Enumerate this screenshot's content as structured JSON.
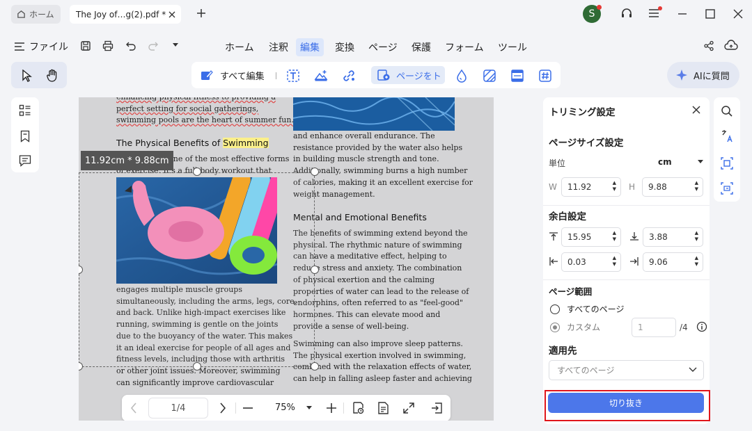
{
  "titlebar": {
    "home_tab": "ホーム",
    "doc_tab": "The Joy of…g(2).pdf *",
    "avatar_letter": "S"
  },
  "menubar": {
    "file_label": "ファイル",
    "menus": [
      "ホーム",
      "注釈",
      "編集",
      "変換",
      "ページ",
      "保護",
      "フォーム",
      "ツール"
    ],
    "active_menu": "編集"
  },
  "toolbar": {
    "edit_all": "すべて編集",
    "page_crop": "ページをト",
    "ai_button": "AIに質問"
  },
  "document": {
    "size_tooltip": "11.92cm * 9.88cm",
    "left_col_top": [
      "enhancing physical fitness to providing a",
      "perfect setting for social gatherings,",
      "swimming pools are the heart of summer fun."
    ],
    "heading1_prefix": "The Physical Benefits of ",
    "heading1_highlight": "Swimming",
    "left_col_mid": [
      "Swimming is one of the most effective forms",
      "of exercise. It's a full-body workout that"
    ],
    "left_col_bottom": [
      "engages multiple muscle groups",
      "simultaneously, including the arms, legs, core,",
      "and back. Unlike high-impact exercises like",
      "running, swimming is gentle on the joints",
      "due to the buoyancy of the water. This makes",
      "it an ideal exercise for people of all ages and",
      "fitness levels, including those with arthritis",
      "or other joint issues. Moreover, swimming",
      "can significantly improve cardiovascular"
    ],
    "right_col_top": [
      "and enhance overall endurance. The",
      "resistance provided by the water also helps",
      "in building muscle strength and tone.",
      "Additionally, swimming burns a high number",
      "of calories, making it an excellent exercise for",
      "weight management."
    ],
    "heading2": "Mental and Emotional Benefits",
    "right_col_mid": [
      "The benefits of swimming extend beyond the",
      "physical. The rhythmic nature of swimming",
      "can have a meditative effect, helping to",
      "reduce stress and anxiety. The combination",
      "of physical exertion and the calming",
      "properties of water can lead to the release of",
      "endorphins, often referred to as \"feel-good\"",
      "hormones. This can elevate mood and",
      "provide a sense of well-being."
    ],
    "right_col_bottom": [
      "Swimming can also improve sleep patterns.",
      "The physical exertion involved in swimming,",
      "combined with the relaxation effects of water,",
      "can help in falling asleep faster and achieving"
    ]
  },
  "pagenav": {
    "page": "1/4",
    "zoom": "75%"
  },
  "crop_panel": {
    "title": "トリミング設定",
    "page_size_title": "ページサイズ設定",
    "unit_label": "単位",
    "unit_value": "cm",
    "w_label": "W",
    "w_value": "11.92",
    "h_label": "H",
    "h_value": "9.88",
    "margin_title": "余白設定",
    "margin_top": "15.95",
    "margin_bottom": "3.88",
    "margin_left": "0.03",
    "margin_right": "9.06",
    "range_title": "ページ範囲",
    "all_pages": "すべてのページ",
    "custom": "カスタム",
    "custom_value": "1",
    "custom_total": "/4",
    "apply_title": "適用先",
    "apply_value": "すべてのページ",
    "crop_button": "切り抜き"
  },
  "colors": {
    "accent": "#3b6ee8",
    "highlight_box": "#e0151b",
    "avatar_bg": "#2f6b35"
  }
}
